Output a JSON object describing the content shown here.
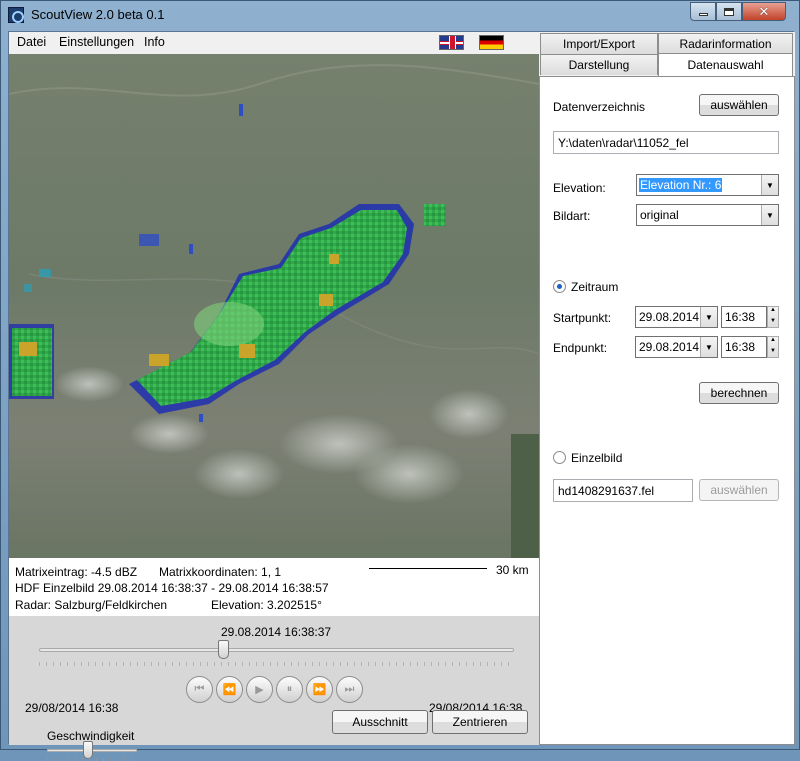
{
  "window": {
    "title": "ScoutView 2.0 beta 0.1"
  },
  "menu": {
    "items": [
      "Datei",
      "Einstellungen",
      "Info"
    ]
  },
  "flags": {
    "uk": "uk-flag-icon",
    "de": "german-flag-icon"
  },
  "info": {
    "matrix_value": "Matrixeintrag: -4.5  dBZ",
    "matrix_coords": "Matrixkoordinaten: 1, 1",
    "hdf_line": "HDF Einzelbild 29.08.2014 16:38:37 - 29.08.2014 16:38:57",
    "radar": "Radar: Salzburg/Feldkirchen",
    "elevation": "Elevation: 3.202515°",
    "scale": "30 km"
  },
  "player": {
    "current_time": "29.08.2014 16:38:37",
    "start_label": "29/08/2014 16:38",
    "end_label": "29/08/2014 16:38",
    "timeline_position": 0.39,
    "speed_label": "Geschwindigkeit",
    "speed_position": 0.45,
    "buttons": [
      "first-icon",
      "rewind-icon",
      "play-icon",
      "pause-icon",
      "fast-forward-icon",
      "last-icon"
    ],
    "cut_label": "Ausschnitt",
    "center_label": "Zentrieren"
  },
  "tabs": {
    "import_export": "Import/Export",
    "radar_info": "Radarinformation",
    "display": "Darstellung",
    "data_selection": "Datenauswahl"
  },
  "form": {
    "directory_label": "Datenverzeichnis",
    "directory_button": "auswählen",
    "directory_value": "Y:\\daten\\radar\\11052_fel",
    "elevation_label": "Elevation:",
    "elevation_value": "Elevation Nr.: 6",
    "image_type_label": "Bildart:",
    "image_type_value": "original",
    "period_label": "Zeitraum",
    "start_label": "Startpunkt:",
    "start_date": "29.08.2014",
    "start_time": "16:38",
    "end_label": "Endpunkt:",
    "end_date": "29.08.2014",
    "end_time": "16:38",
    "compute_button": "berechnen",
    "single_label": "Einzelbild",
    "single_value": "hd1408291637.fel",
    "single_button": "auswählen"
  }
}
